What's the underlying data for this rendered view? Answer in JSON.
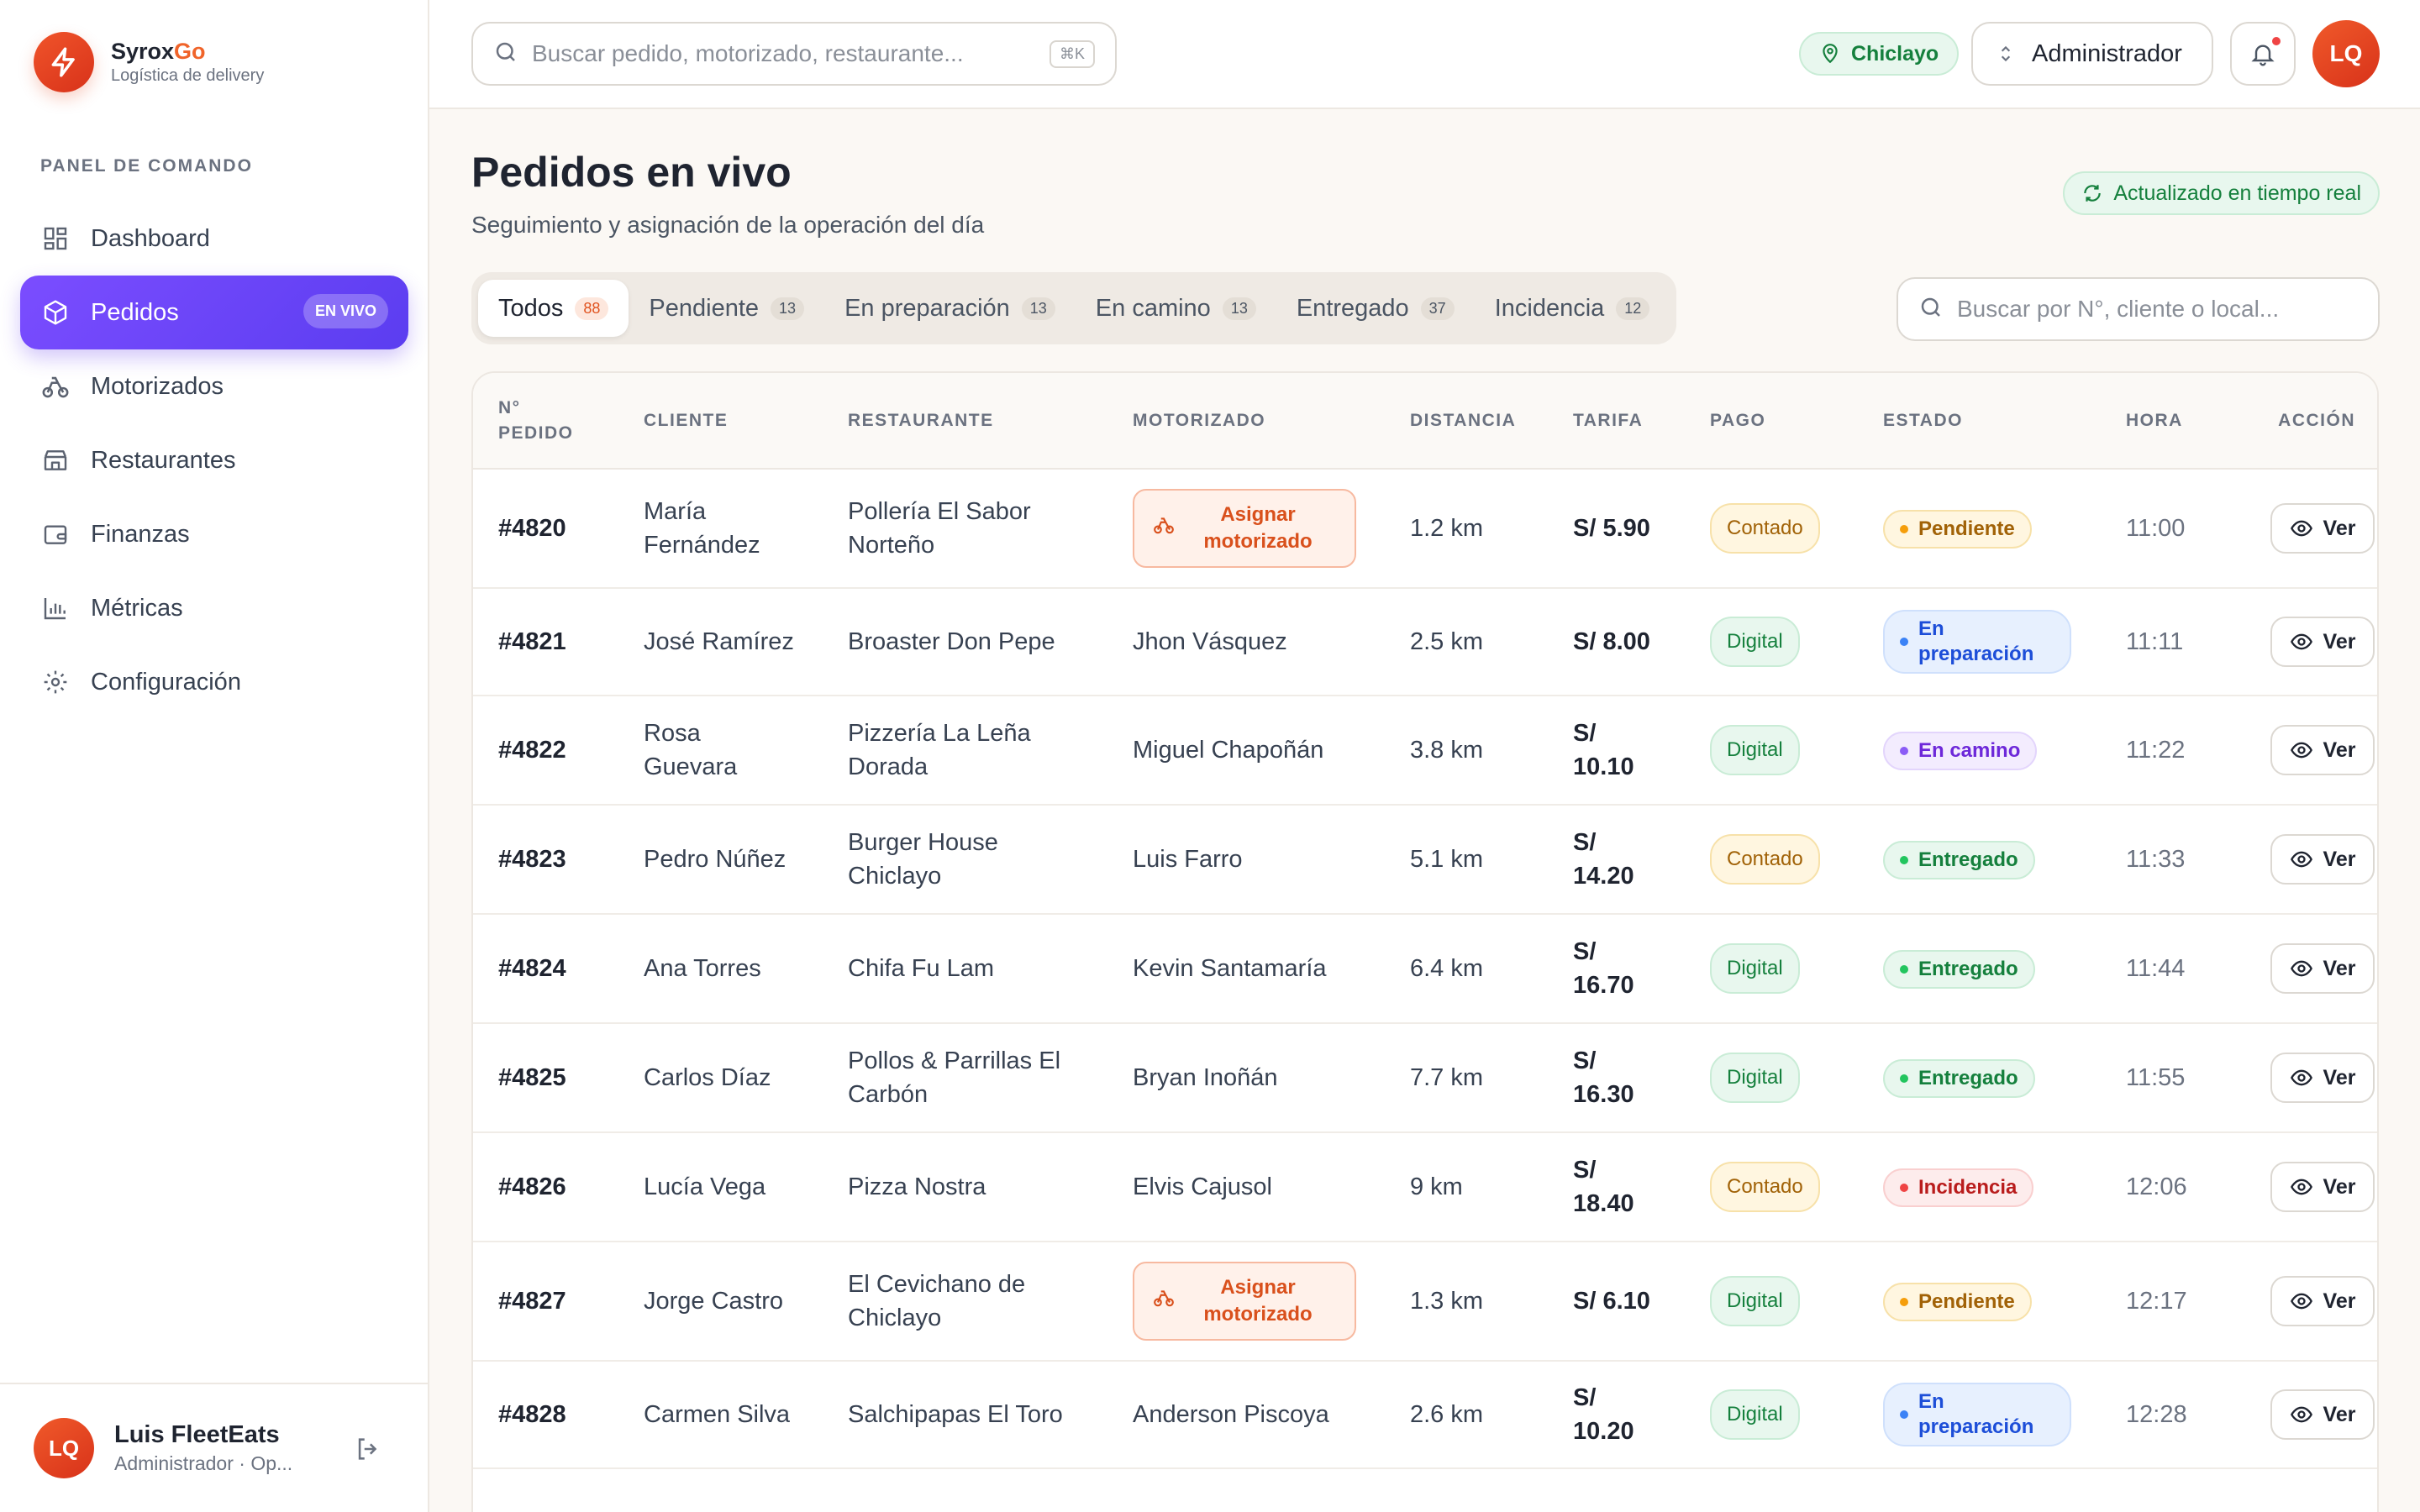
{
  "brand": {
    "name_part1": "Syrox",
    "name_part2": "Go",
    "subtitle": "Logística de delivery"
  },
  "sidebar": {
    "section_title": "PANEL DE COMANDO",
    "items": [
      {
        "label": "Dashboard",
        "icon": "grid-icon"
      },
      {
        "label": "Pedidos",
        "icon": "box-icon",
        "badge": "EN VIVO",
        "active": true
      },
      {
        "label": "Motorizados",
        "icon": "bike-icon"
      },
      {
        "label": "Restaurantes",
        "icon": "store-icon"
      },
      {
        "label": "Finanzas",
        "icon": "wallet-icon"
      },
      {
        "label": "Métricas",
        "icon": "bar-chart-icon"
      },
      {
        "label": "Configuración",
        "icon": "gear-icon"
      }
    ],
    "user": {
      "initials": "LQ",
      "name": "Luis FleetEats",
      "role": "Administrador · Op..."
    }
  },
  "topbar": {
    "search_placeholder": "Buscar pedido, motorizado, restaurante...",
    "shortcut": "⌘K",
    "city": "Chiclayo",
    "role": "Administrador",
    "avatar_initials": "LQ"
  },
  "page": {
    "title": "Pedidos en vivo",
    "subtitle": "Seguimiento y asignación de la operación del día",
    "realtime_label": "Actualizado en tiempo real",
    "table_search_placeholder": "Buscar por N°, cliente o local..."
  },
  "tabs": [
    {
      "label": "Todos",
      "count": "88",
      "active": true
    },
    {
      "label": "Pendiente",
      "count": "13"
    },
    {
      "label": "En preparación",
      "count": "13"
    },
    {
      "label": "En camino",
      "count": "13"
    },
    {
      "label": "Entregado",
      "count": "37"
    },
    {
      "label": "Incidencia",
      "count": "12"
    }
  ],
  "table": {
    "headers": [
      "N° PEDIDO",
      "CLIENTE",
      "RESTAURANTE",
      "MOTORIZADO",
      "DISTANCIA",
      "TARIFA",
      "PAGO",
      "ESTADO",
      "HORA",
      "ACCIÓN"
    ],
    "assign_label": "Asignar motorizado",
    "view_label": "Ver",
    "rows": [
      {
        "order": "#4820",
        "client": "María Fernández",
        "restaurant": "Pollería El Sabor Norteño",
        "rider": "",
        "distance": "1.2 km",
        "fare": "S/ 5.90",
        "payment": "Contado",
        "status": "Pendiente",
        "hour": "11:00"
      },
      {
        "order": "#4821",
        "client": "José Ramírez",
        "restaurant": "Broaster Don Pepe",
        "rider": "Jhon Vásquez",
        "distance": "2.5 km",
        "fare": "S/ 8.00",
        "payment": "Digital",
        "status": "En preparación",
        "hour": "11:11"
      },
      {
        "order": "#4822",
        "client": "Rosa Guevara",
        "restaurant": "Pizzería La Leña Dorada",
        "rider": "Miguel Chapoñán",
        "distance": "3.8 km",
        "fare": "S/ 10.10",
        "payment": "Digital",
        "status": "En camino",
        "hour": "11:22"
      },
      {
        "order": "#4823",
        "client": "Pedro Núñez",
        "restaurant": "Burger House Chiclayo",
        "rider": "Luis Farro",
        "distance": "5.1 km",
        "fare": "S/ 14.20",
        "payment": "Contado",
        "status": "Entregado",
        "hour": "11:33"
      },
      {
        "order": "#4824",
        "client": "Ana Torres",
        "restaurant": "Chifa Fu Lam",
        "rider": "Kevin Santamaría",
        "distance": "6.4 km",
        "fare": "S/ 16.70",
        "payment": "Digital",
        "status": "Entregado",
        "hour": "11:44"
      },
      {
        "order": "#4825",
        "client": "Carlos Díaz",
        "restaurant": "Pollos & Parrillas El Carbón",
        "rider": "Bryan Inoñán",
        "distance": "7.7 km",
        "fare": "S/ 16.30",
        "payment": "Digital",
        "status": "Entregado",
        "hour": "11:55"
      },
      {
        "order": "#4826",
        "client": "Lucía Vega",
        "restaurant": "Pizza Nostra",
        "rider": "Elvis Cajusol",
        "distance": "9 km",
        "fare": "S/ 18.40",
        "payment": "Contado",
        "status": "Incidencia",
        "hour": "12:06"
      },
      {
        "order": "#4827",
        "client": "Jorge Castro",
        "restaurant": "El Cevichano de Chiclayo",
        "rider": "",
        "distance": "1.3 km",
        "fare": "S/ 6.10",
        "payment": "Digital",
        "status": "Pendiente",
        "hour": "12:17"
      },
      {
        "order": "#4828",
        "client": "Carmen Silva",
        "restaurant": "Salchipapas El Toro",
        "rider": "Anderson Piscoya",
        "distance": "2.6 km",
        "fare": "S/ 10.20",
        "payment": "Digital",
        "status": "En preparación",
        "hour": "12:28"
      }
    ]
  },
  "colors": {
    "accent": "#6b45f5",
    "brand": "#f0542a",
    "success": "#15803d"
  }
}
